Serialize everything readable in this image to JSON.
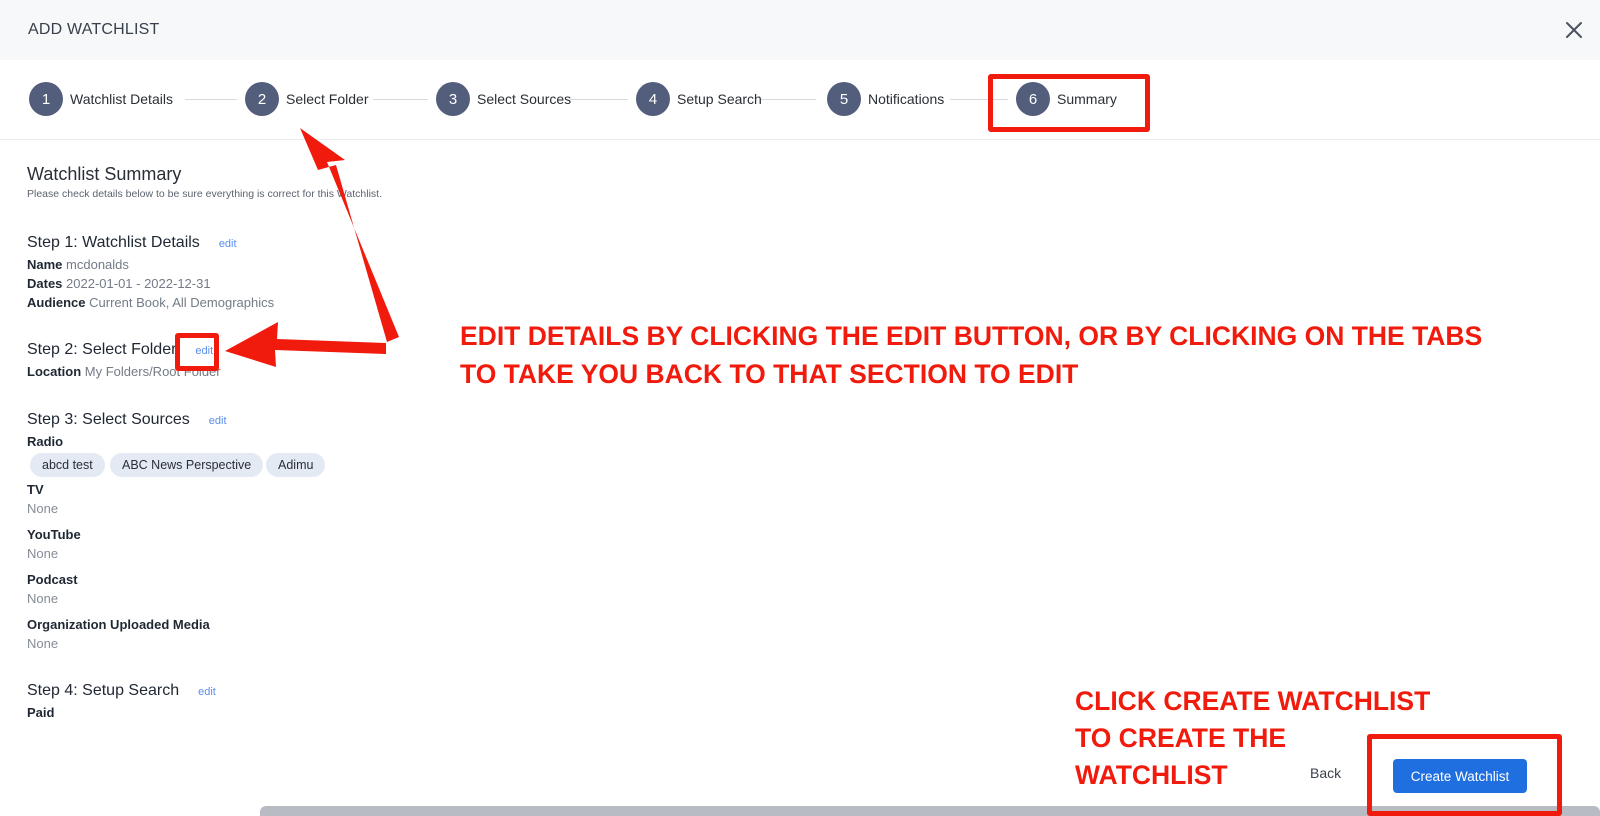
{
  "header": {
    "title": "ADD WATCHLIST"
  },
  "stepper": {
    "steps": [
      {
        "number": "1",
        "label": "Watchlist Details"
      },
      {
        "number": "2",
        "label": "Select Folder"
      },
      {
        "number": "3",
        "label": "Select Sources"
      },
      {
        "number": "4",
        "label": "Setup Search"
      },
      {
        "number": "5",
        "label": "Notifications"
      },
      {
        "number": "6",
        "label": "Summary"
      }
    ]
  },
  "summary": {
    "title": "Watchlist Summary",
    "subtitle": "Please check details below to be sure everything is correct for this Watchlist.",
    "step1": {
      "heading": "Step 1: Watchlist Details",
      "edit": "edit",
      "name_key": "Name",
      "name_value": "mcdonalds",
      "dates_key": "Dates",
      "dates_value": "2022-01-01 - 2022-12-31",
      "audience_key": "Audience",
      "audience_value": "Current Book, All Demographics"
    },
    "step2": {
      "heading": "Step 2: Select Folder",
      "edit": "edit",
      "location_key": "Location",
      "location_value": "My Folders/Root Folder"
    },
    "step3": {
      "heading": "Step 3: Select Sources",
      "edit": "edit",
      "radio_label": "Radio",
      "radio_chips": [
        "abcd test",
        "ABC News Perspective",
        "Adimu"
      ],
      "tv_label": "TV",
      "tv_value": "None",
      "youtube_label": "YouTube",
      "youtube_value": "None",
      "podcast_label": "Podcast",
      "podcast_value": "None",
      "org_label": "Organization Uploaded Media",
      "org_value": "None"
    },
    "step4": {
      "heading": "Step 4: Setup Search",
      "edit": "edit",
      "paid_label": "Paid"
    }
  },
  "footer": {
    "back_label": "Back",
    "create_label": "Create Watchlist"
  },
  "annotations": {
    "edit_line1": "EDIT DETAILS BY CLICKING THE EDIT BUTTON, OR BY CLICKING ON THE TABS",
    "edit_line2": "TO TAKE YOU BACK TO THAT SECTION TO EDIT",
    "create_line1": "CLICK CREATE WATCHLIST",
    "create_line2": "TO CREATE THE",
    "create_line3": "WATCHLIST"
  },
  "colors": {
    "accent": "#1f6fe0",
    "annotation": "#f01b0c",
    "step_circle": "#535d7c",
    "link": "#5b8def"
  },
  "icons": {
    "close": "close-icon",
    "arrow": "arrow-icon"
  }
}
